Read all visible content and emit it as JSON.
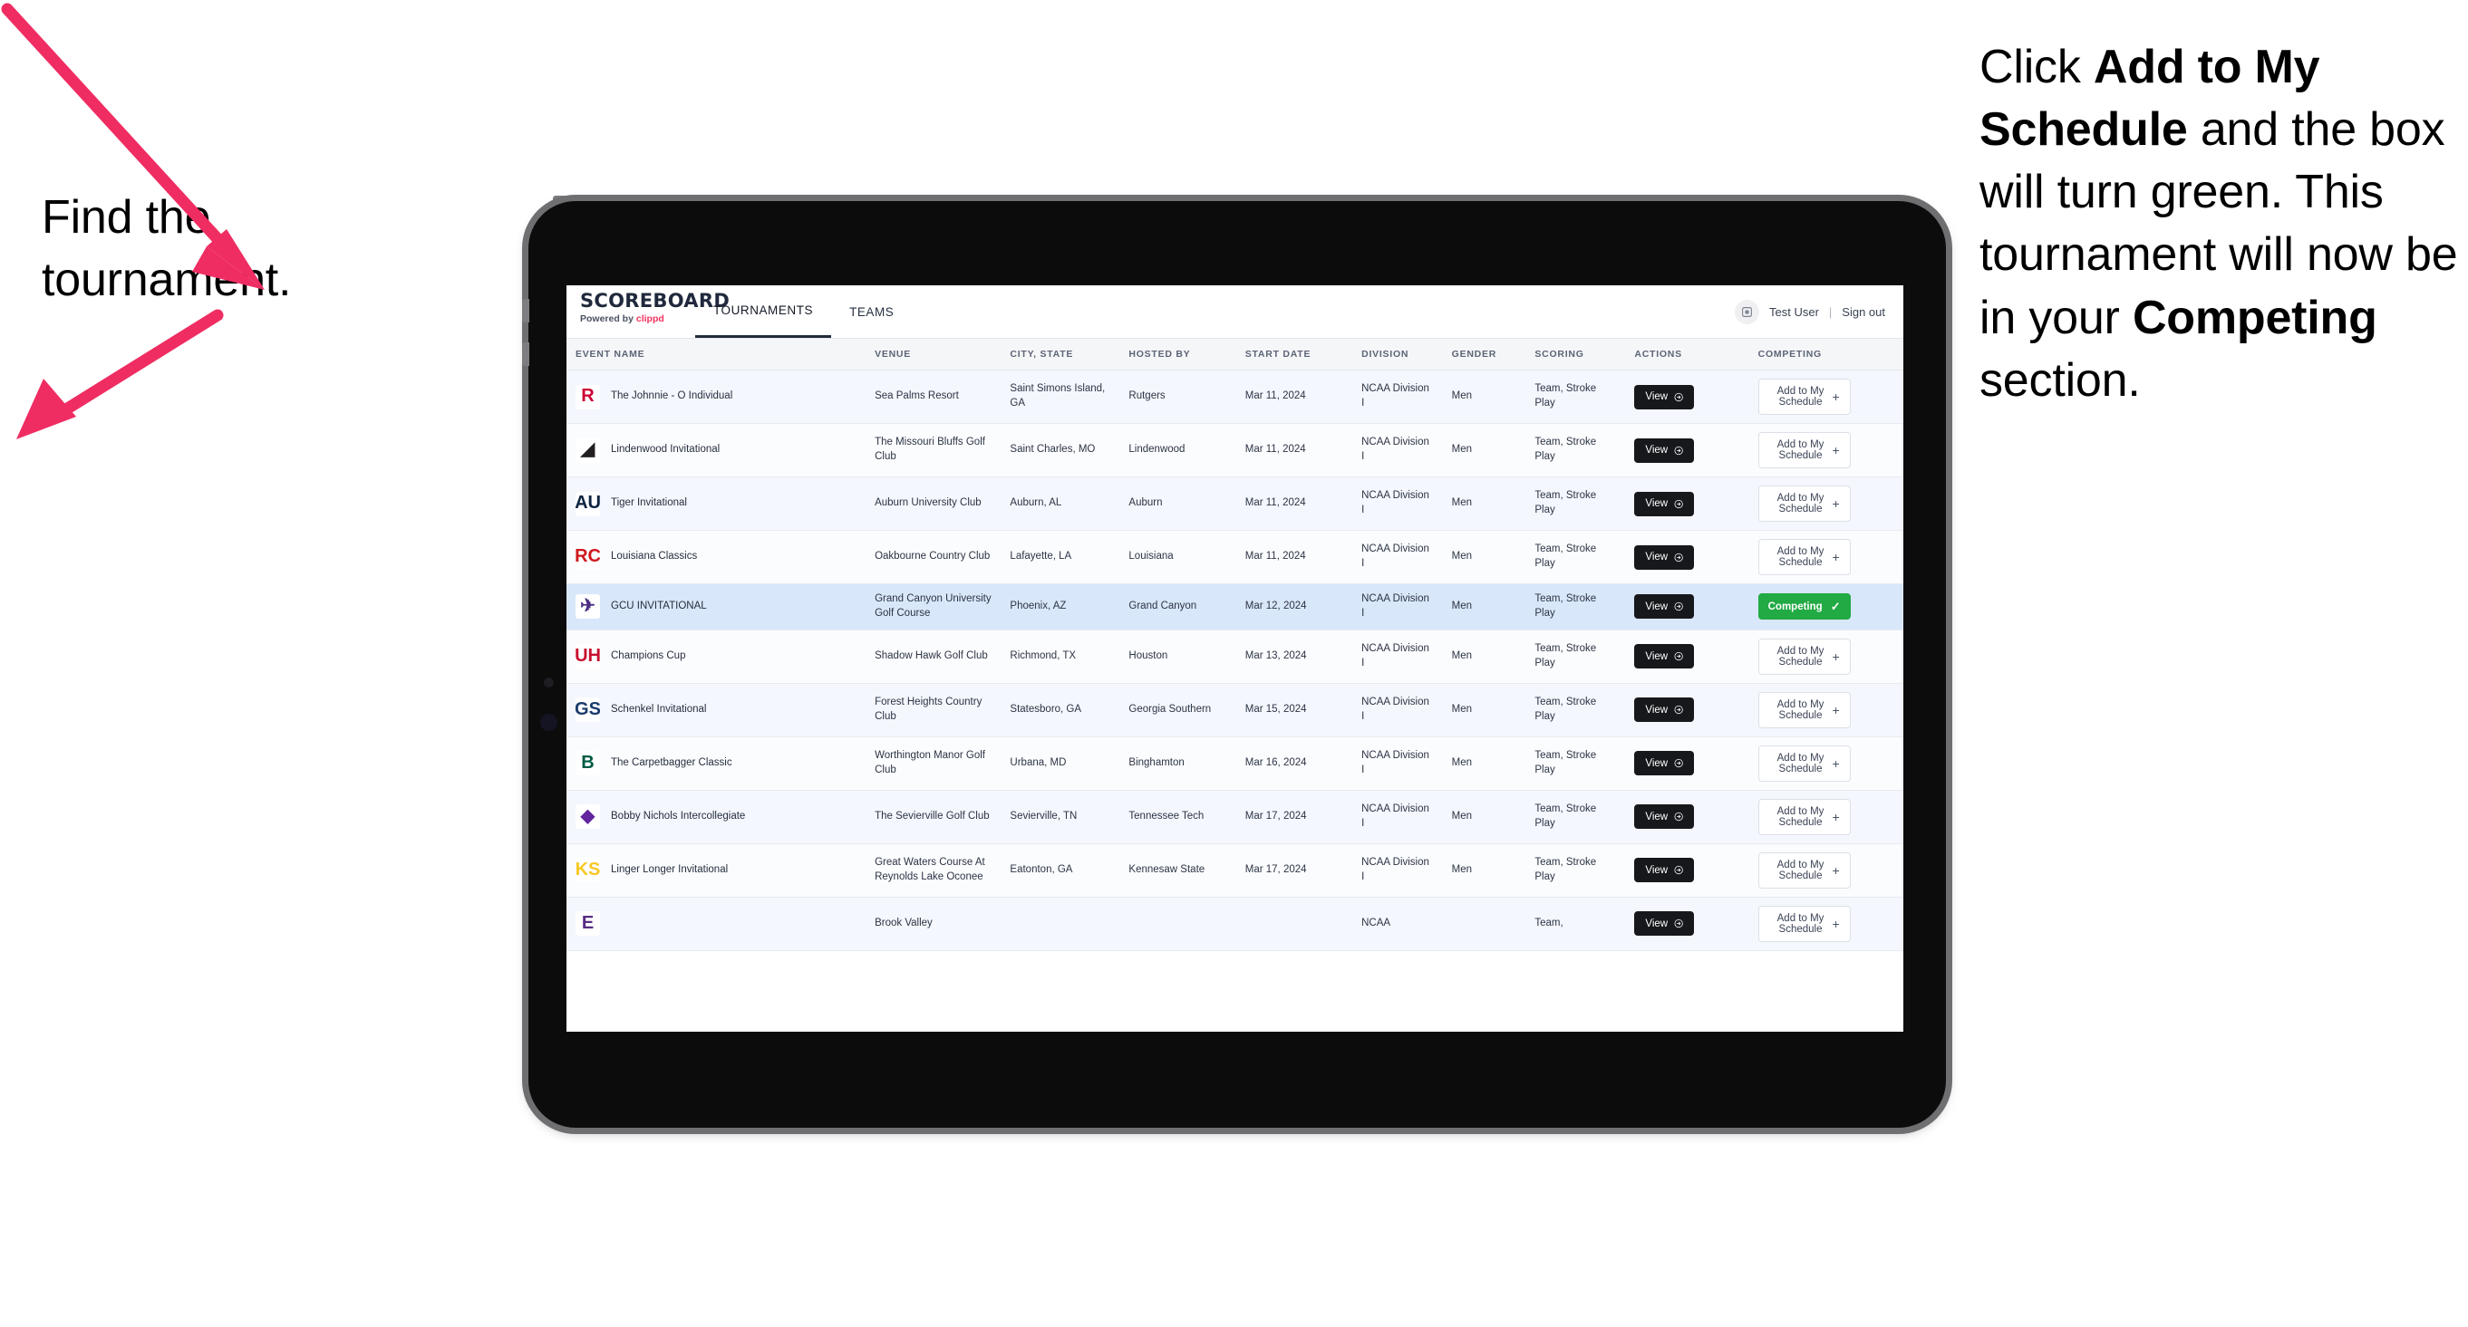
{
  "annotations": {
    "left": {
      "line1": "Find the",
      "line2": "tournament."
    },
    "right": {
      "p1_pre": "Click ",
      "p1_bold": "Add to My Schedule",
      "p1_post": " and the box will turn green. This tournament will now be in your ",
      "p2_bold": "Competing",
      "p2_post": " section."
    }
  },
  "app": {
    "brand_name": "SCOREBOARD",
    "brand_powered_pre": "Powered by ",
    "brand_powered_by": "clippd",
    "nav_tabs": [
      {
        "label": "TOURNAMENTS",
        "active": true
      },
      {
        "label": "TEAMS",
        "active": false
      }
    ],
    "user": {
      "avatar_icon": "user-badge-icon",
      "name": "Test User",
      "separator": "|",
      "signout": "Sign out"
    }
  },
  "table": {
    "columns": [
      "EVENT NAME",
      "VENUE",
      "CITY, STATE",
      "HOSTED BY",
      "START DATE",
      "DIVISION",
      "GENDER",
      "SCORING",
      "ACTIONS",
      "COMPETING"
    ],
    "action_view_label": "View",
    "action_view_icon": "arrow-right-circle-icon",
    "action_add_label": "Add to My Schedule",
    "action_add_icon": "plus-icon",
    "action_competing_label": "Competing",
    "action_competing_icon": "check-icon",
    "competing_color": "#22aa44",
    "selected_row_color": "#d9e7fb",
    "rows": [
      {
        "logo_text": "R",
        "logo_bg": "#ffffff",
        "logo_fg": "#cc0033",
        "event": "The Johnnie - O Individual",
        "venue": "Sea Palms Resort",
        "city": "Saint Simons Island, GA",
        "host": "Rutgers",
        "date": "Mar 11, 2024",
        "division": "NCAA Division I",
        "gender": "Men",
        "scoring": "Team, Stroke Play",
        "competing": false
      },
      {
        "logo_text": "◢",
        "logo_bg": "#ffffff",
        "logo_fg": "#231f20",
        "event": "Lindenwood Invitational",
        "venue": "The Missouri Bluffs Golf Club",
        "city": "Saint Charles, MO",
        "host": "Lindenwood",
        "date": "Mar 11, 2024",
        "division": "NCAA Division I",
        "gender": "Men",
        "scoring": "Team, Stroke Play",
        "competing": false
      },
      {
        "logo_text": "AU",
        "logo_bg": "#ffffff",
        "logo_fg": "#0c2340",
        "event": "Tiger Invitational",
        "venue": "Auburn University Club",
        "city": "Auburn, AL",
        "host": "Auburn",
        "date": "Mar 11, 2024",
        "division": "NCAA Division I",
        "gender": "Men",
        "scoring": "Team, Stroke Play",
        "competing": false
      },
      {
        "logo_text": "RC",
        "logo_bg": "#ffffff",
        "logo_fg": "#ce181e",
        "event": "Louisiana Classics",
        "venue": "Oakbourne Country Club",
        "city": "Lafayette, LA",
        "host": "Louisiana",
        "date": "Mar 11, 2024",
        "division": "NCAA Division I",
        "gender": "Men",
        "scoring": "Team, Stroke Play",
        "competing": false
      },
      {
        "logo_text": "✈",
        "logo_bg": "#ffffff",
        "logo_fg": "#4b2e83",
        "event": "GCU INVITATIONAL",
        "venue": "Grand Canyon University Golf Course",
        "city": "Phoenix, AZ",
        "host": "Grand Canyon",
        "date": "Mar 12, 2024",
        "division": "NCAA Division I",
        "gender": "Men",
        "scoring": "Team, Stroke Play",
        "competing": true,
        "selected": true
      },
      {
        "logo_text": "UH",
        "logo_bg": "#ffffff",
        "logo_fg": "#c8102e",
        "event": "Champions Cup",
        "venue": "Shadow Hawk Golf Club",
        "city": "Richmond, TX",
        "host": "Houston",
        "date": "Mar 13, 2024",
        "division": "NCAA Division I",
        "gender": "Men",
        "scoring": "Team, Stroke Play",
        "competing": false
      },
      {
        "logo_text": "GS",
        "logo_bg": "#ffffff",
        "logo_fg": "#1a3a6b",
        "event": "Schenkel Invitational",
        "venue": "Forest Heights Country Club",
        "city": "Statesboro, GA",
        "host": "Georgia Southern",
        "date": "Mar 15, 2024",
        "division": "NCAA Division I",
        "gender": "Men",
        "scoring": "Team, Stroke Play",
        "competing": false
      },
      {
        "logo_text": "B",
        "logo_bg": "#ffffff",
        "logo_fg": "#005a43",
        "event": "The Carpetbagger Classic",
        "venue": "Worthington Manor Golf Club",
        "city": "Urbana, MD",
        "host": "Binghamton",
        "date": "Mar 16, 2024",
        "division": "NCAA Division I",
        "gender": "Men",
        "scoring": "Team, Stroke Play",
        "competing": false
      },
      {
        "logo_text": "◆",
        "logo_bg": "#ffffff",
        "logo_fg": "#62259d",
        "event": "Bobby Nichols Intercollegiate",
        "venue": "The Sevierville Golf Club",
        "city": "Sevierville, TN",
        "host": "Tennessee Tech",
        "date": "Mar 17, 2024",
        "division": "NCAA Division I",
        "gender": "Men",
        "scoring": "Team, Stroke Play",
        "competing": false
      },
      {
        "logo_text": "KS",
        "logo_bg": "#ffffff",
        "logo_fg": "#f7c825",
        "event": "Linger Longer Invitational",
        "venue": "Great Waters Course At Reynolds Lake Oconee",
        "city": "Eatonton, GA",
        "host": "Kennesaw State",
        "date": "Mar 17, 2024",
        "division": "NCAA Division I",
        "gender": "Men",
        "scoring": "Team, Stroke Play",
        "competing": false
      },
      {
        "logo_text": "E",
        "logo_bg": "#ffffff",
        "logo_fg": "#582c83",
        "event": "",
        "venue": "Brook Valley",
        "city": "",
        "host": "",
        "date": "",
        "division": "NCAA",
        "gender": "",
        "scoring": "Team,",
        "competing": false,
        "partial": true
      }
    ]
  }
}
